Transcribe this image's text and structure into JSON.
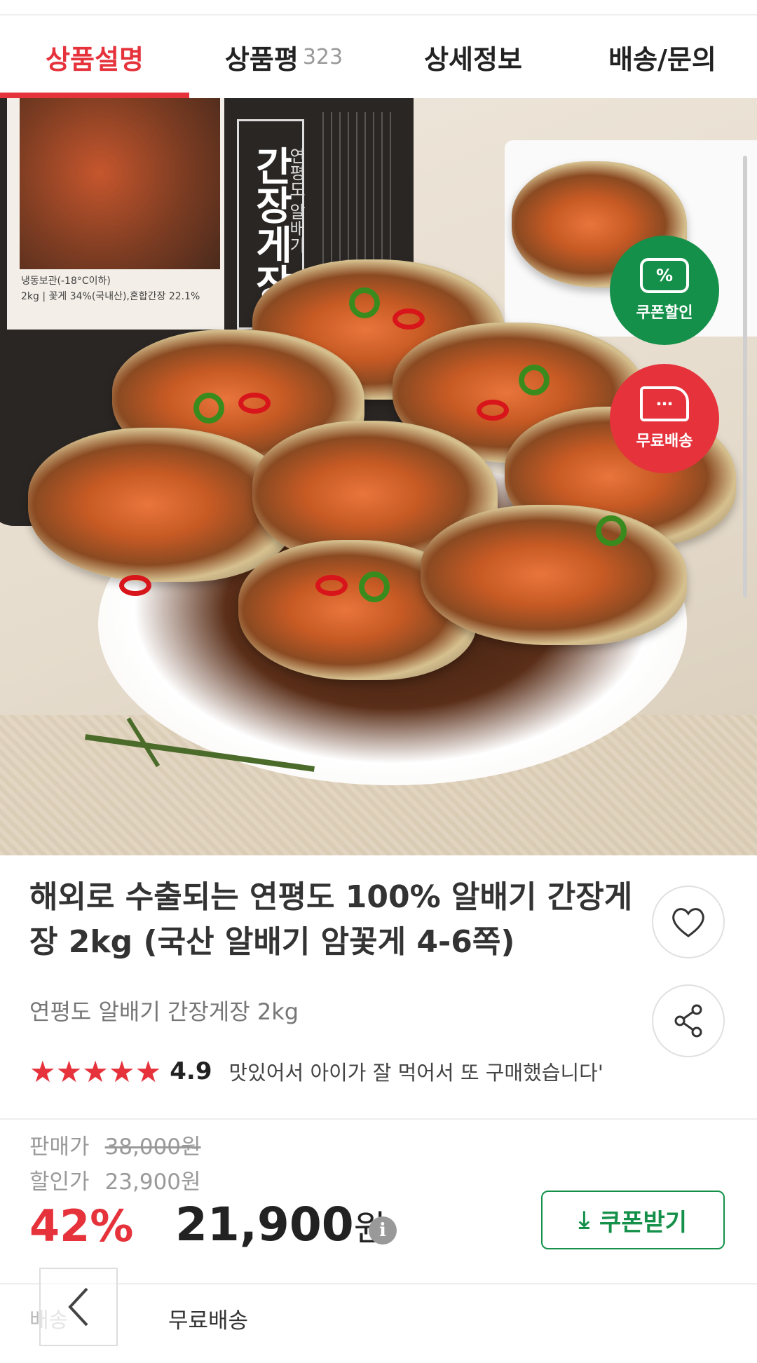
{
  "tabs": [
    {
      "label": "상품설명",
      "active": true
    },
    {
      "label": "상품평",
      "count": "323"
    },
    {
      "label": "상세정보"
    },
    {
      "label": "배송/문의"
    }
  ],
  "hero": {
    "jar_title": "간장게장",
    "jar_subtitle": "연평도 알배기",
    "jar_small_1": "냉동보관(-18°C이하)",
    "jar_small_2": "2kg | 꽃게 34%(국내산),혼합간장 22.1%",
    "badges": {
      "coupon_icon": "%",
      "coupon_label": "쿠폰할인",
      "shipping_label": "무료배송"
    }
  },
  "product": {
    "title": "해외로 수출되는 연평도 100% 알배기 간장게장 2kg (국산 알배기 암꽃게 4-6쪽)",
    "subtitle": "연평도 알배기 간장게장 2kg",
    "stars": "★★★★★",
    "rating": "4.9",
    "review_snippet": "맛있어서 아이가 잘 먹어서 또 구매했습니다'"
  },
  "price": {
    "sale_label": "판매가",
    "sale_value": "38,000원",
    "discount_label": "할인가",
    "discount_value": "23,900원",
    "discount_rate": "42%",
    "final_number": "21,900",
    "final_unit": "원",
    "info_icon": "i",
    "coupon_button": "쿠폰받기"
  },
  "shipping": {
    "label": "배송",
    "value": "무료배송"
  },
  "colors": {
    "accent_red": "#e5323b",
    "coupon_green": "#15904a"
  }
}
